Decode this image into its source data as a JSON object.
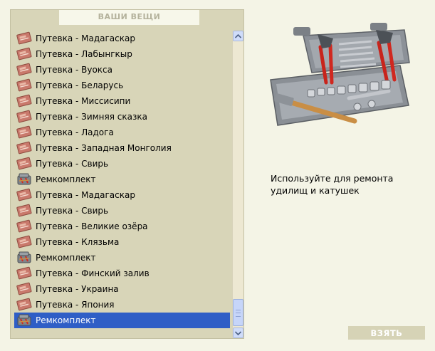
{
  "inventory": {
    "title": "ВАШИ ВЕЩИ",
    "items": [
      {
        "label": "Путевка - Мадагаскар",
        "icon": "voucher-icon"
      },
      {
        "label": "Путевка - Лабынгкыр",
        "icon": "voucher-icon"
      },
      {
        "label": "Путевка - Вуокса",
        "icon": "voucher-icon"
      },
      {
        "label": "Путевка - Беларусь",
        "icon": "voucher-icon"
      },
      {
        "label": "Путевка - Миссисипи",
        "icon": "voucher-icon"
      },
      {
        "label": "Путевка - Зимняя сказка",
        "icon": "voucher-icon"
      },
      {
        "label": "Путевка - Ладога",
        "icon": "voucher-icon"
      },
      {
        "label": "Путевка - Западная Монголия",
        "icon": "voucher-icon"
      },
      {
        "label": "Путевка - Свирь",
        "icon": "voucher-icon"
      },
      {
        "label": "Ремкомплект",
        "icon": "repair-kit-icon"
      },
      {
        "label": "Путевка - Мадагаскар",
        "icon": "voucher-icon"
      },
      {
        "label": "Путевка - Свирь",
        "icon": "voucher-icon"
      },
      {
        "label": "Путевка - Великие озёра",
        "icon": "voucher-icon"
      },
      {
        "label": "Путевка - Клязьма",
        "icon": "voucher-icon"
      },
      {
        "label": "Ремкомплект",
        "icon": "repair-kit-icon"
      },
      {
        "label": "Путевка - Финский залив",
        "icon": "voucher-icon"
      },
      {
        "label": "Путевка - Украина",
        "icon": "voucher-icon"
      },
      {
        "label": "Путевка - Япония",
        "icon": "voucher-icon"
      },
      {
        "label": "Ремкомплект",
        "icon": "repair-kit-icon",
        "selected": true
      }
    ],
    "scroll_position": 0.95
  },
  "details": {
    "image": "toolbox-image",
    "description": "Используйте для ремонта удилищ и катушек"
  },
  "actions": {
    "take_label": "ВЗЯТЬ"
  },
  "colors": {
    "panel_bg": "#d8d5b8",
    "page_bg": "#f4f4e6",
    "selection": "#2f5ec6"
  }
}
